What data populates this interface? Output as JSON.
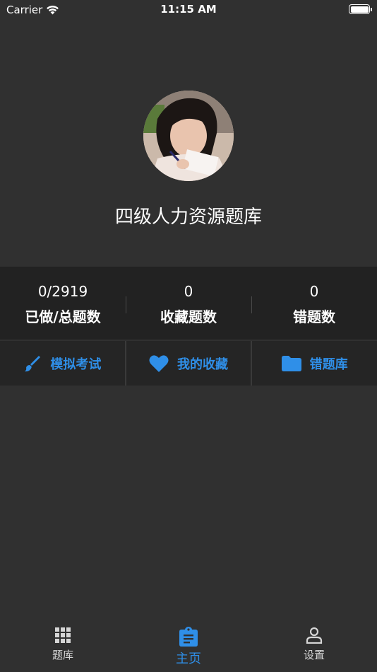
{
  "status_bar": {
    "carrier": "Carrier",
    "time": "11:15 AM"
  },
  "profile": {
    "title": "四级人力资源题库"
  },
  "stats": [
    {
      "value": "0/2919",
      "label": "已做/总题数"
    },
    {
      "value": "0",
      "label": "收藏题数"
    },
    {
      "value": "0",
      "label": "错题数"
    }
  ],
  "actions": [
    {
      "label": "模拟考试",
      "icon": "brush-icon"
    },
    {
      "label": "我的收藏",
      "icon": "heart-icon"
    },
    {
      "label": "错题库",
      "icon": "folder-icon"
    }
  ],
  "tabbar": {
    "items": [
      {
        "label": "题库",
        "icon": "grid-icon",
        "active": false
      },
      {
        "label": "主页",
        "icon": "clipboard-icon",
        "active": true
      },
      {
        "label": "设置",
        "icon": "person-icon",
        "active": false
      }
    ]
  },
  "colors": {
    "background": "#303030",
    "band": "#222222",
    "accent": "#2f8fe8"
  }
}
